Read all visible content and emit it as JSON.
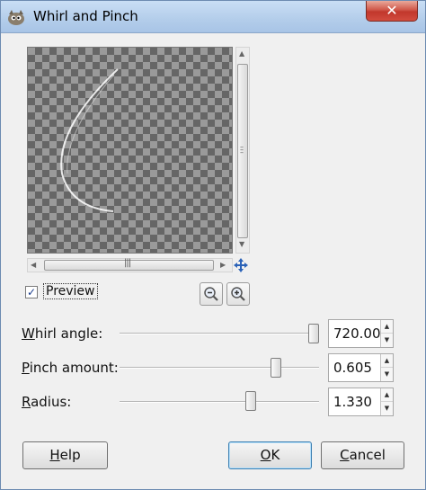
{
  "window": {
    "title": "Whirl and Pinch",
    "close_glyph": "✕",
    "app_icon": "gimp-icon"
  },
  "preview": {
    "checkbox_label": "Preview",
    "checked": true
  },
  "params": [
    {
      "label": "Whirl angle:",
      "mnemonic": "W",
      "rest": "hirl angle:",
      "value": "720.00",
      "slider_fraction": 1.0
    },
    {
      "label": "Pinch amount:",
      "mnemonic": "P",
      "rest": "inch amount:",
      "value": "0.605",
      "slider_fraction": 0.8
    },
    {
      "label": "Radius:",
      "mnemonic": "R",
      "rest": "adius:",
      "value": "1.330",
      "slider_fraction": 0.665
    }
  ],
  "buttons": {
    "help": {
      "label": "Help",
      "mnemonic": "H",
      "rest": "elp"
    },
    "ok": {
      "label": "OK",
      "mnemonic": "O",
      "rest": "K"
    },
    "cancel": {
      "label": "Cancel",
      "mnemonic": "C",
      "rest": "ancel"
    }
  },
  "icons": [
    "gimp-icon",
    "close-icon",
    "navigate-icon",
    "zoom-out-icon",
    "zoom-in-icon",
    "checkmark-icon"
  ]
}
